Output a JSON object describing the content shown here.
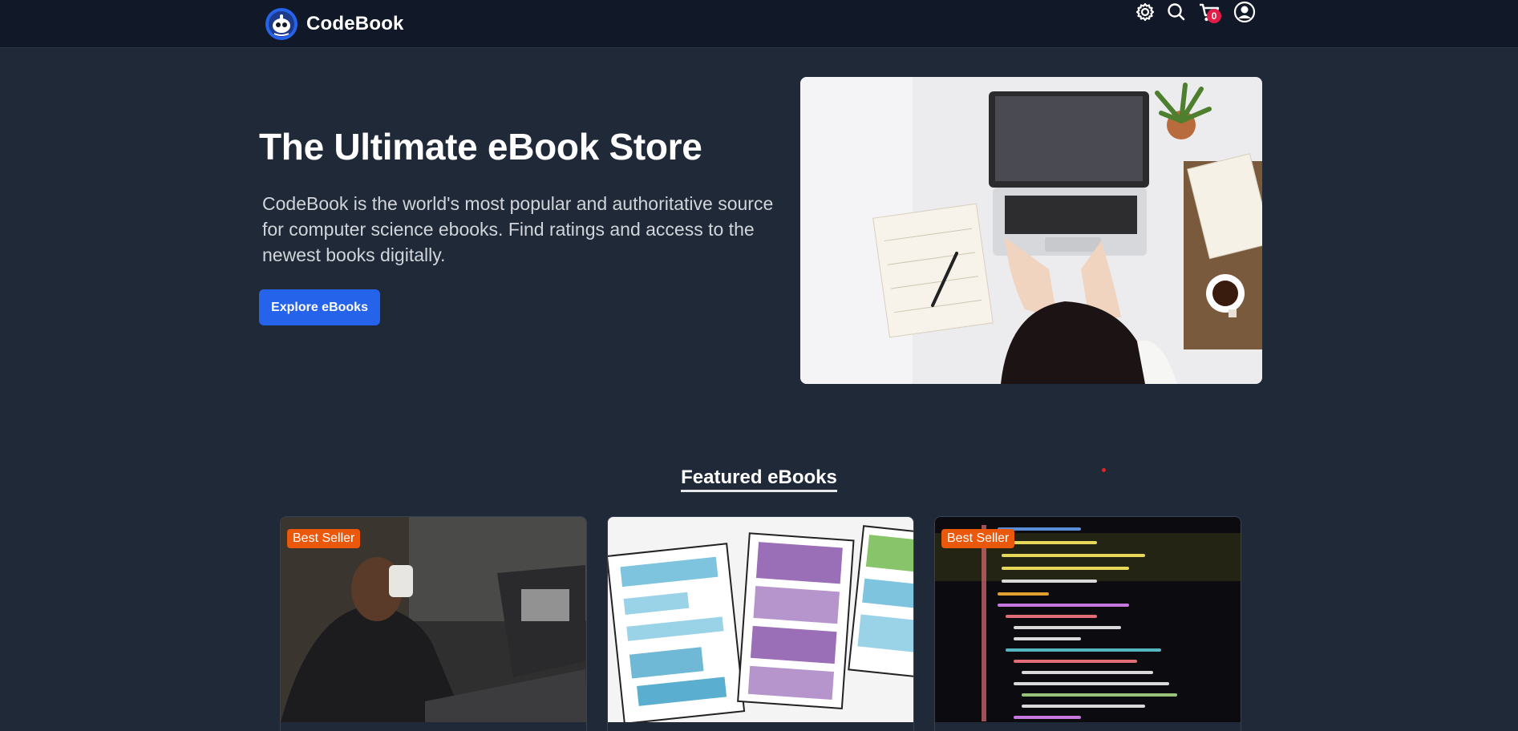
{
  "header": {
    "brand_name": "CodeBook",
    "icons": [
      "gear-icon",
      "search-icon",
      "cart-icon",
      "user-icon"
    ],
    "cart_count": "0"
  },
  "hero": {
    "title": "The Ultimate eBook Store",
    "description": "CodeBook is the world's most popular and authoritative source for computer science ebooks. Find ratings and access to the newest books digitally.",
    "button_label": "Explore eBooks",
    "image": "woman-working-on-laptop-photo"
  },
  "featured": {
    "title": "Featured eBooks",
    "cards": [
      {
        "badge": "Best Seller",
        "image": "man-drinking-coffee-at-laptop-photo"
      },
      {
        "badge": "",
        "image": "wireframe-sketches-photo"
      },
      {
        "badge": "Best Seller",
        "image": "code-on-screen-photo"
      }
    ]
  },
  "colors": {
    "background": "#1f2937",
    "navbar": "#111827",
    "accent": "#2563eb",
    "badge": "#ea580c",
    "cart_badge": "#e11d48"
  }
}
